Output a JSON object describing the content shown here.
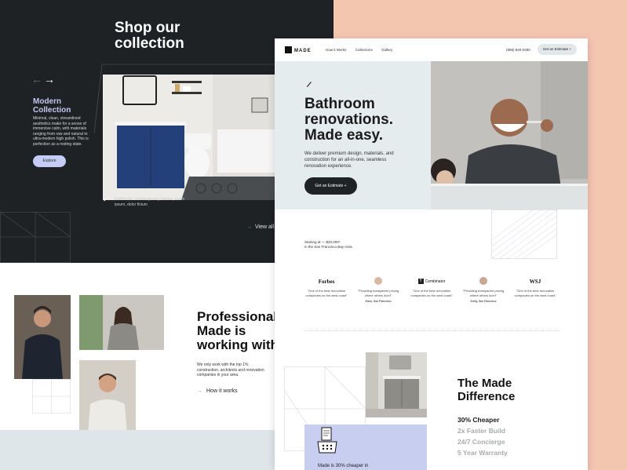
{
  "collection": {
    "title": "Shop our collection",
    "modern_title": "Modern Collection",
    "modern_desc": "Minimal, clean, streamlined aesthetics make for a sense of immersive calm, with materials ranging from raw and natural to ultra-modern high polish. This is perfection as a resting state.",
    "explore_label": "Explore",
    "perfect_text": "Perfect for: Contemporary homes, lorem ipsum, dolor finium",
    "view_all_label": "View all"
  },
  "professional": {
    "title": "Professional Made is working with",
    "desc": "We only work with the top 1% construction, architects and renovation companies in your area.",
    "how_label": "How it works"
  },
  "site": {
    "logo": "MADE",
    "nav_links": [
      "How it Works",
      "Collections",
      "Gallery"
    ],
    "phone": "(888) 840-0280",
    "nav_cta": "Get an Estimate +",
    "hero_title": "Bathroom renovations. Made easy.",
    "hero_desc": "We deliver premium design, materials, and construction for an all-in-one, seamless renovation experience.",
    "hero_cta": "Get an Estimate +",
    "starting_line1": "Starting at — $20,000*",
    "starting_line2": "in the San Francisco Bay Area.",
    "press": [
      {
        "logo": "Forbes",
        "quote": "\"One of the best renovation companies on the west coast\"",
        "author": ""
      },
      {
        "logo": "",
        "quote": "\"Providing transparent pricing where others don't\"",
        "author": "Steve, San Francisco"
      },
      {
        "logo": "Combinator",
        "quote": "\"One of the best renovation companies on the west coast\"",
        "author": ""
      },
      {
        "logo": "",
        "quote": "\"Providing transparent pricing where others don't\"",
        "author": "Emily, San Francisco"
      },
      {
        "logo": "WSJ",
        "quote": "\"One of the best renovation companies on the west coast\"",
        "author": ""
      }
    ],
    "diff_title": "The Made Difference",
    "diff_items": [
      "30% Cheaper",
      "2x Faster Build",
      "24/7 Concierge",
      "5 Year Warranty"
    ],
    "lav_text": "Made is 30% cheaper in"
  },
  "colors": {
    "dark": "#1f2224",
    "peach": "#f3c6b0",
    "lavender": "#c8ceef",
    "hero_bg": "#e4ecee"
  }
}
